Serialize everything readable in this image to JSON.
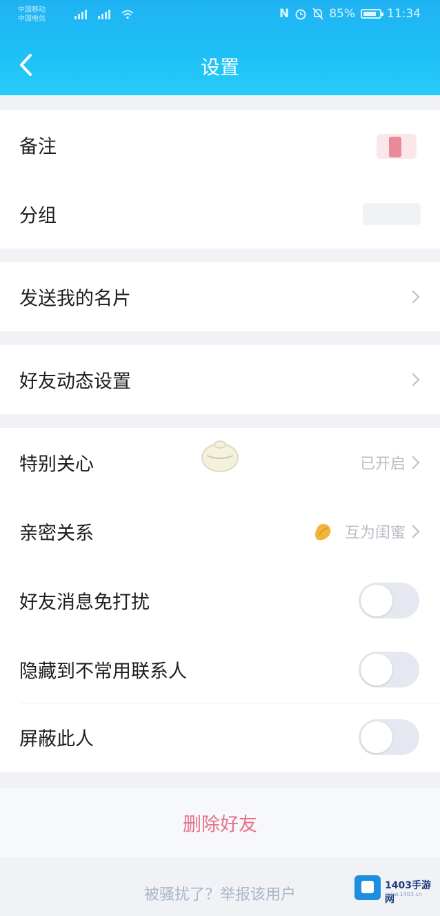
{
  "status_bar": {
    "carrier_1": "中国移动",
    "carrier_2": "中国电信",
    "battery": "85%",
    "time": "11:34",
    "icons": [
      "nfc-icon",
      "alarm-icon",
      "silent-icon",
      "battery-icon",
      "wifi-icon",
      "signal-icon"
    ]
  },
  "header": {
    "title": "设置",
    "back_icon": "chevron-left-icon"
  },
  "sections": {
    "remark": {
      "label": "备注"
    },
    "group": {
      "label": "分组"
    },
    "send_card": {
      "label": "发送我的名片"
    },
    "feed_settings": {
      "label": "好友动态设置"
    },
    "special_care": {
      "label": "特别关心",
      "value": "已开启"
    },
    "intimacy": {
      "label": "亲密关系",
      "value": "互为闺蜜",
      "icon": "badge-icon"
    },
    "do_not_disturb": {
      "label": "好友消息免打扰",
      "on": false
    },
    "hide_contact": {
      "label": "隐藏到不常用联系人",
      "on": false
    },
    "block": {
      "label": "屏蔽此人",
      "on": false
    }
  },
  "delete_friend": "删除好友",
  "report_link": "被骚扰了？举报该用户",
  "watermark": {
    "text": "1403手游网",
    "sub": "www.1403.cn"
  },
  "colors": {
    "header": "#1fb8f4",
    "danger": "#e6708b",
    "muted": "#b9bcc4"
  }
}
